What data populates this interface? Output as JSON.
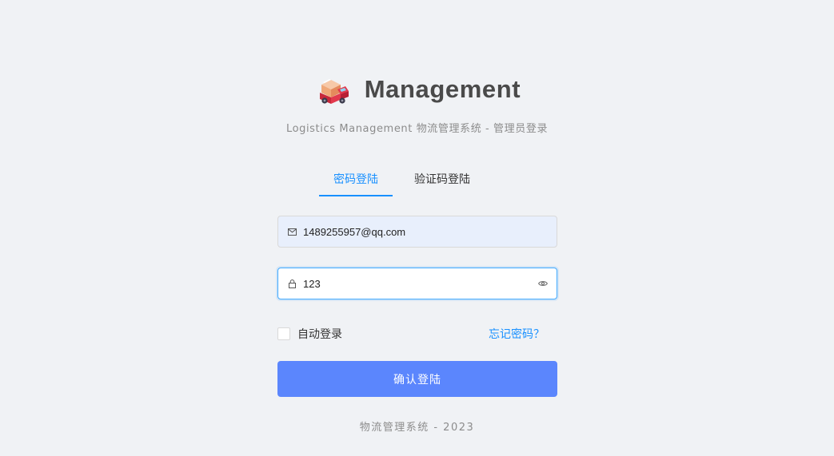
{
  "brand": {
    "title": "Management",
    "logo_icon": "truck-logo-icon"
  },
  "subtitle": "Logistics Management 物流管理系统 - 管理员登录",
  "tabs": [
    {
      "label": "密码登陆",
      "active": true
    },
    {
      "label": "验证码登陆",
      "active": false
    }
  ],
  "form": {
    "email": {
      "value": "1489255957@qq.com",
      "icon": "mail-icon"
    },
    "password": {
      "value": "123",
      "icon": "lock-icon",
      "toggle_icon": "eye-icon"
    },
    "remember_label": "自动登录",
    "remember_checked": false,
    "forgot_label": "忘记密码？",
    "submit_label": "确认登陆"
  },
  "footer": "物流管理系统 - 2023",
  "colors": {
    "background": "#f0f2f5",
    "accent": "#1890ff",
    "button": "#5b86fd",
    "email_fill": "#e8effc"
  }
}
